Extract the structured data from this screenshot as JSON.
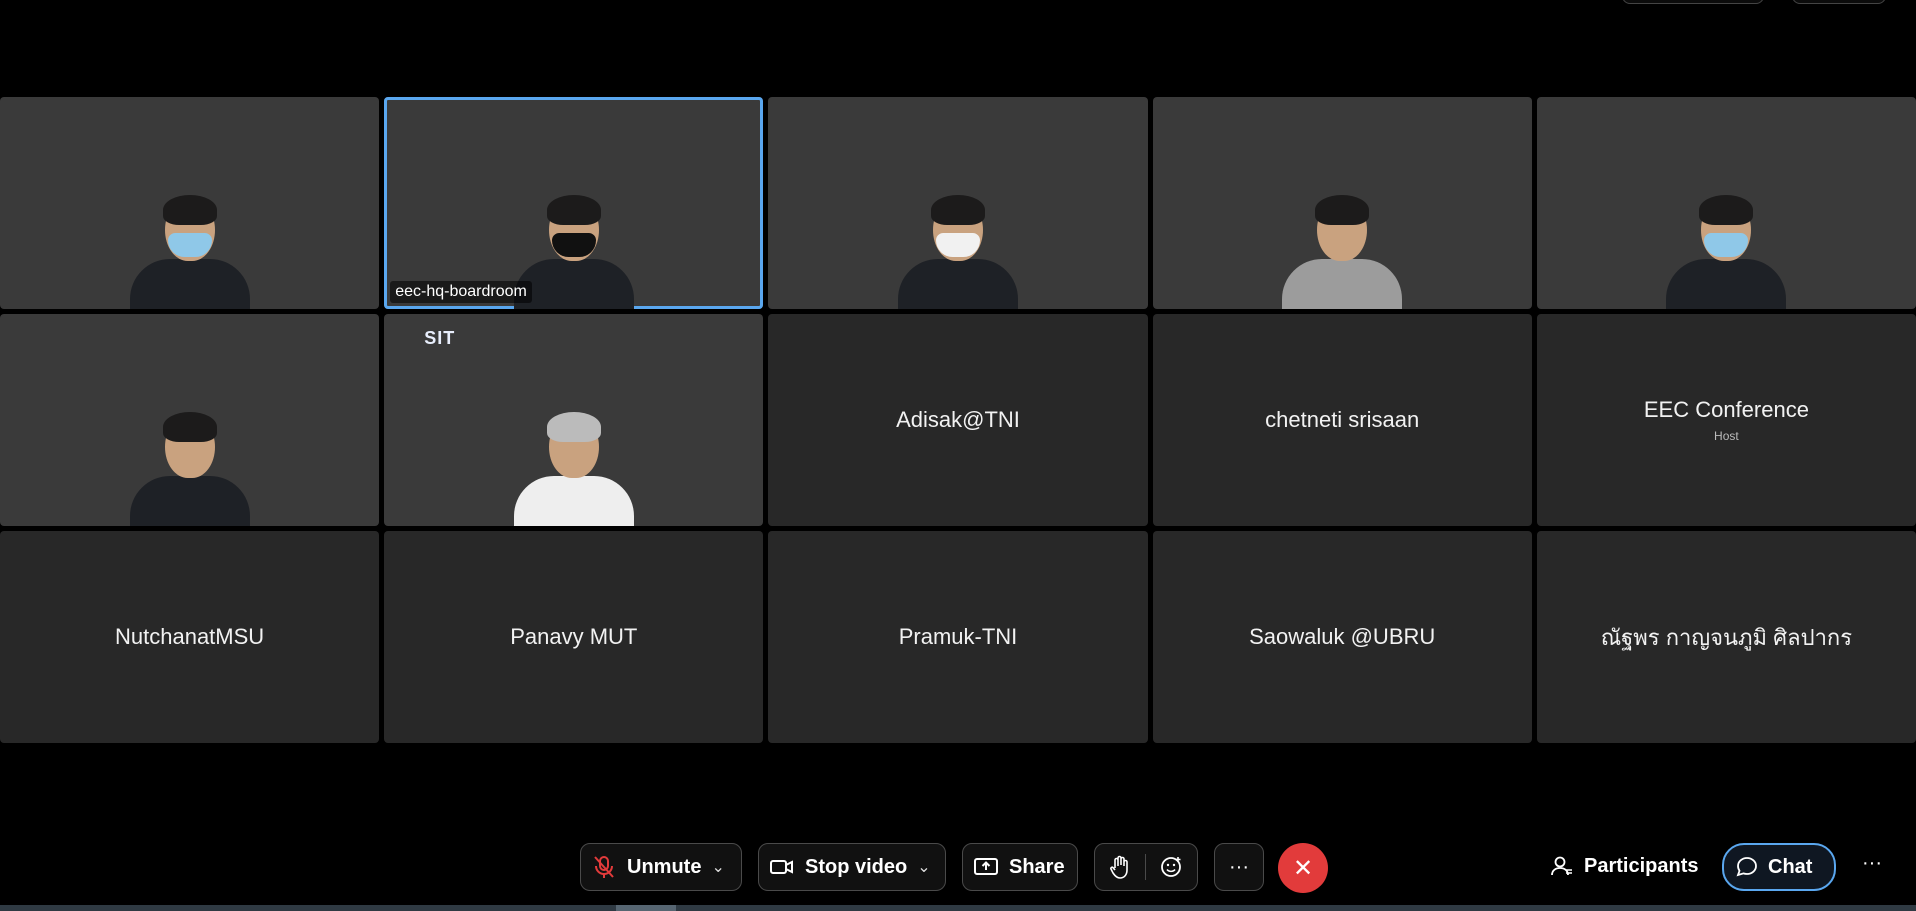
{
  "participants": [
    {
      "name": "",
      "label": "",
      "video": true
    },
    {
      "name": "",
      "label": "eec-hq-boardroom",
      "video": true,
      "active": true
    },
    {
      "name": "",
      "label": "",
      "video": true
    },
    {
      "name": "",
      "label": "",
      "video": true
    },
    {
      "name": "",
      "label": "",
      "video": true
    },
    {
      "name": "",
      "label": "",
      "video": true
    },
    {
      "name": "",
      "label": "",
      "video": true,
      "banner": "SIT"
    },
    {
      "name": "Adisak@TNI",
      "role": ""
    },
    {
      "name": "chetneti srisaan",
      "role": ""
    },
    {
      "name": "EEC Conference",
      "role": "Host"
    },
    {
      "name": "NutchanatMSU",
      "role": ""
    },
    {
      "name": "Panavy MUT",
      "role": ""
    },
    {
      "name": "Pramuk-TNI",
      "role": ""
    },
    {
      "name": "Saowaluk @UBRU",
      "role": ""
    },
    {
      "name": "ณัฐพร กาญจนภูมิ ศิลปากร",
      "role": ""
    }
  ],
  "toolbar": {
    "unmute_label": "Unmute",
    "stop_video_label": "Stop video",
    "share_label": "Share",
    "more_label": "···",
    "participants_label": "Participants",
    "chat_label": "Chat",
    "overflow_label": "···"
  },
  "colors": {
    "accent": "#5aa7ef",
    "end_call": "#e23b3b",
    "tile_bg": "#282828"
  }
}
